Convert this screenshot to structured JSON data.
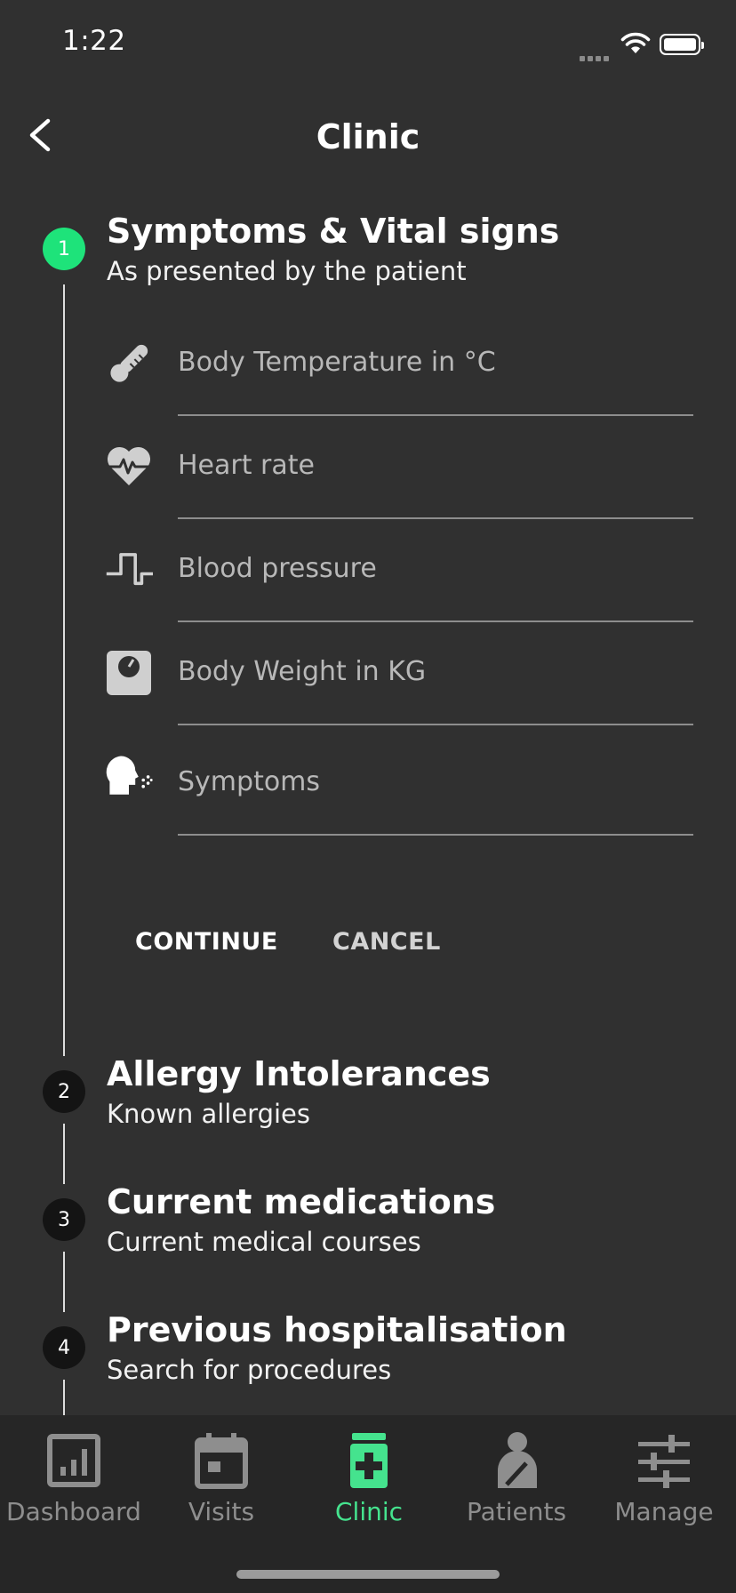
{
  "status_bar": {
    "time": "1:22"
  },
  "header": {
    "title": "Clinic"
  },
  "steps": [
    {
      "number": "1",
      "title": "Symptoms & Vital signs",
      "subtitle": "As presented by the patient"
    },
    {
      "number": "2",
      "title": "Allergy Intolerances",
      "subtitle": "Known allergies"
    },
    {
      "number": "3",
      "title": "Current medications",
      "subtitle": "Current medical courses"
    },
    {
      "number": "4",
      "title": "Previous hospitalisation",
      "subtitle": "Search for procedures"
    }
  ],
  "fields": [
    {
      "icon": "thermometer-icon",
      "placeholder": "Body Temperature in °C"
    },
    {
      "icon": "heart-rate-icon",
      "placeholder": "Heart rate"
    },
    {
      "icon": "blood-pressure-icon",
      "placeholder": "Blood pressure"
    },
    {
      "icon": "weight-scale-icon",
      "placeholder": "Body Weight in KG"
    },
    {
      "icon": "head-cough-icon",
      "placeholder": "Symptoms"
    }
  ],
  "actions": {
    "continue": "CONTINUE",
    "cancel": "CANCEL"
  },
  "tabs": [
    {
      "label": "Dashboard",
      "icon": "dashboard-icon"
    },
    {
      "label": "Visits",
      "icon": "calendar-icon"
    },
    {
      "label": "Clinic",
      "icon": "clinic-icon",
      "active": true
    },
    {
      "label": "Patients",
      "icon": "patient-icon"
    },
    {
      "label": "Manage",
      "icon": "sliders-icon"
    }
  ],
  "colors": {
    "background": "#303030",
    "accent": "#1ee37a",
    "tab_active": "#45e38e",
    "tab_inactive": "#8e8e8e"
  }
}
